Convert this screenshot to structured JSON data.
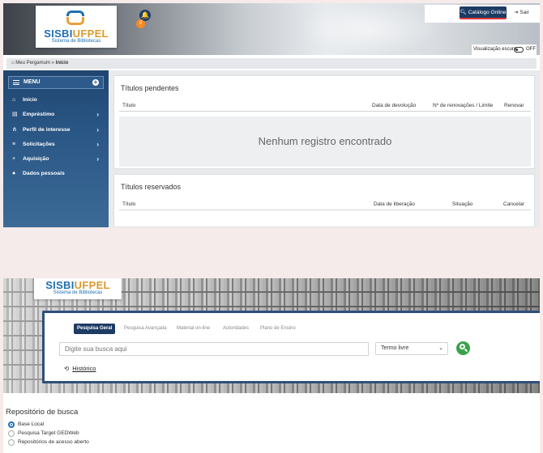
{
  "top": {
    "logo": {
      "name_a": "SISBI",
      "name_b": "UFPEL",
      "subtitle": "Sistema de Bibliotecas"
    },
    "notifications": {
      "bell": "🔔",
      "count": "0"
    },
    "catalog_button": "Catálogo Online",
    "exit_link": "Sair",
    "dark_mode": {
      "label": "Visualização escura",
      "state": "OFF"
    },
    "breadcrumb": {
      "root": "Meu Pergamum",
      "separator": "»",
      "current": "Início"
    },
    "menu": {
      "title": "MENU",
      "items": [
        {
          "label": "Início",
          "icon": "home-icon",
          "expandable": false
        },
        {
          "label": "Empréstimo",
          "icon": "book-icon",
          "expandable": true
        },
        {
          "label": "Perfil de interesse",
          "icon": "sitemap-icon",
          "expandable": true
        },
        {
          "label": "Solicitações",
          "icon": "list-icon",
          "expandable": true
        },
        {
          "label": "Aquisição",
          "icon": "plus-icon",
          "expandable": true
        },
        {
          "label": "Dados pessoais",
          "icon": "user-icon",
          "expandable": false
        }
      ]
    },
    "pending": {
      "title": "Títulos pendentes",
      "columns": [
        "Título",
        "Data de devolução",
        "Nº de renovações / Limite",
        "Renovar"
      ],
      "empty_message": "Nenhum registro encontrado"
    },
    "reserved": {
      "title": "Títulos reservados",
      "columns": [
        "Título",
        "Data de liberação",
        "Situação",
        "Cancelar"
      ]
    }
  },
  "bottom": {
    "logo": {
      "name_a": "SISBI",
      "name_b": "UFPEL",
      "subtitle": "Sistema de Bibliotecas"
    },
    "tabs": [
      "Pesquisa Geral",
      "Pesquisa Avançada",
      "Material on-line",
      "Autoridades",
      "Plano de Ensino"
    ],
    "active_tab": "Pesquisa Geral",
    "search": {
      "placeholder": "Digite sua busca aqui",
      "value": ""
    },
    "search_type": "Termo livre",
    "history_link": "Histórico",
    "repository": {
      "title": "Repositório de busca",
      "options": [
        "Base Local",
        "Pesquisa Target GEDWeb",
        "Repositórios de acesso aberto"
      ],
      "selected": "Base Local"
    }
  },
  "colors": {
    "navy": "#1d3b63",
    "menu_blue": "#2a5786",
    "search_green": "#3aa34a",
    "badge_orange": "#f08a24",
    "accent_red": "#e23b3b"
  }
}
